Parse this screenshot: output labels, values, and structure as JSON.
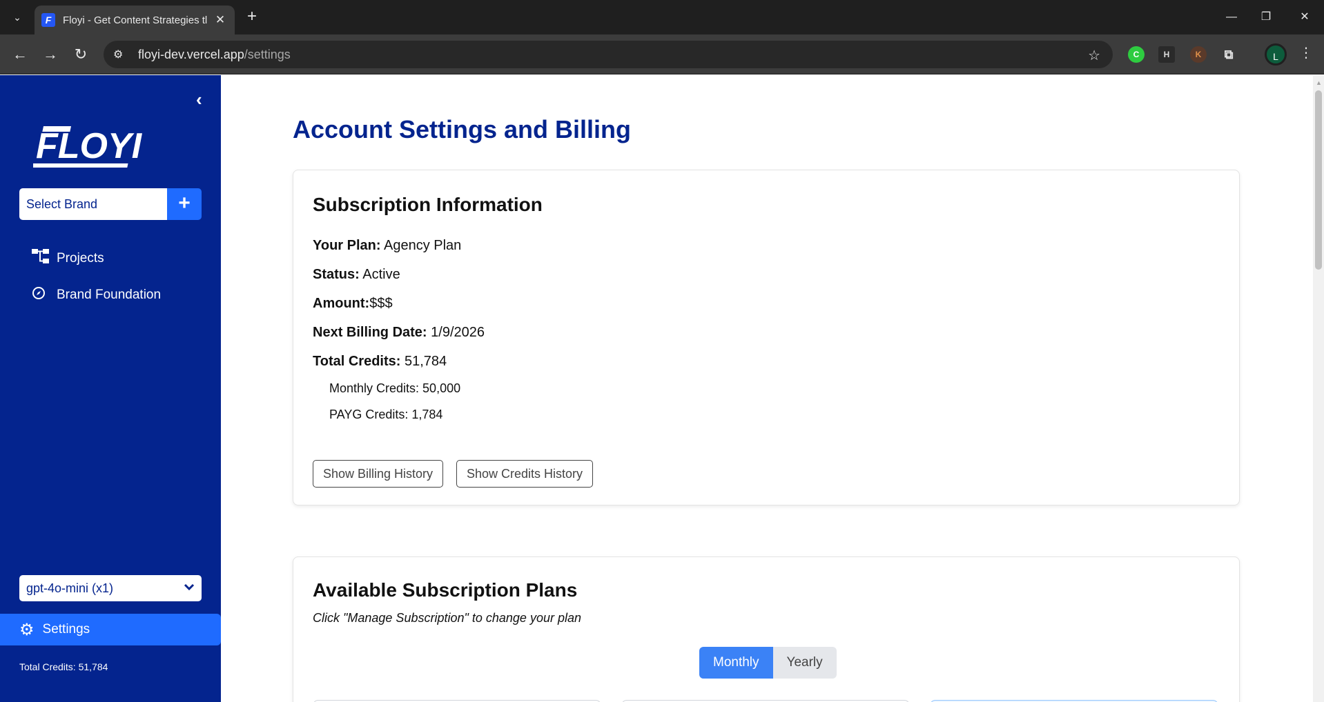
{
  "browser": {
    "tab_title": "Floyi - Get Content Strategies tl",
    "tab_favicon": "F",
    "url_domain": "floyi-dev.vercel.app",
    "url_path": "/settings",
    "profile_initial": "L",
    "extensions": [
      "C",
      "H",
      "K"
    ]
  },
  "sidebar": {
    "logo_text": "FLOYI",
    "brand_select_placeholder": "Select Brand",
    "nav": [
      {
        "label": "Projects",
        "icon": "sitemap-icon"
      },
      {
        "label": "Brand Foundation",
        "icon": "compass-icon"
      }
    ],
    "model_select_value": "gpt-4o-mini (x1)",
    "settings_label": "Settings",
    "total_credits_text": "Total Credits: 51,784"
  },
  "main": {
    "page_title": "Account Settings and Billing",
    "subscription": {
      "title": "Subscription Information",
      "plan_label": "Your Plan:",
      "plan_value": " Agency Plan",
      "status_label": "Status:",
      "status_value": " Active",
      "amount_label": "Amount:",
      "amount_value": "$$$",
      "billing_label": "Next Billing Date:",
      "billing_value": " 1/9/2026",
      "credits_label": "Total Credits:",
      "credits_value": " 51,784",
      "monthly_credits": "Monthly Credits: 50,000",
      "payg_credits": "PAYG Credits: 1,784",
      "billing_history_button": "Show Billing History",
      "credits_history_button": "Show Credits History"
    },
    "plans": {
      "title": "Available Subscription Plans",
      "subtitle": "Click \"Manage Subscription\" to change your plan",
      "toggle_monthly": "Monthly",
      "toggle_yearly": "Yearly"
    }
  },
  "colors": {
    "sidebar_bg": "#04248e",
    "accent_blue": "#1f6bff",
    "title_blue": "#04248e",
    "toggle_active": "#3b82f6"
  }
}
